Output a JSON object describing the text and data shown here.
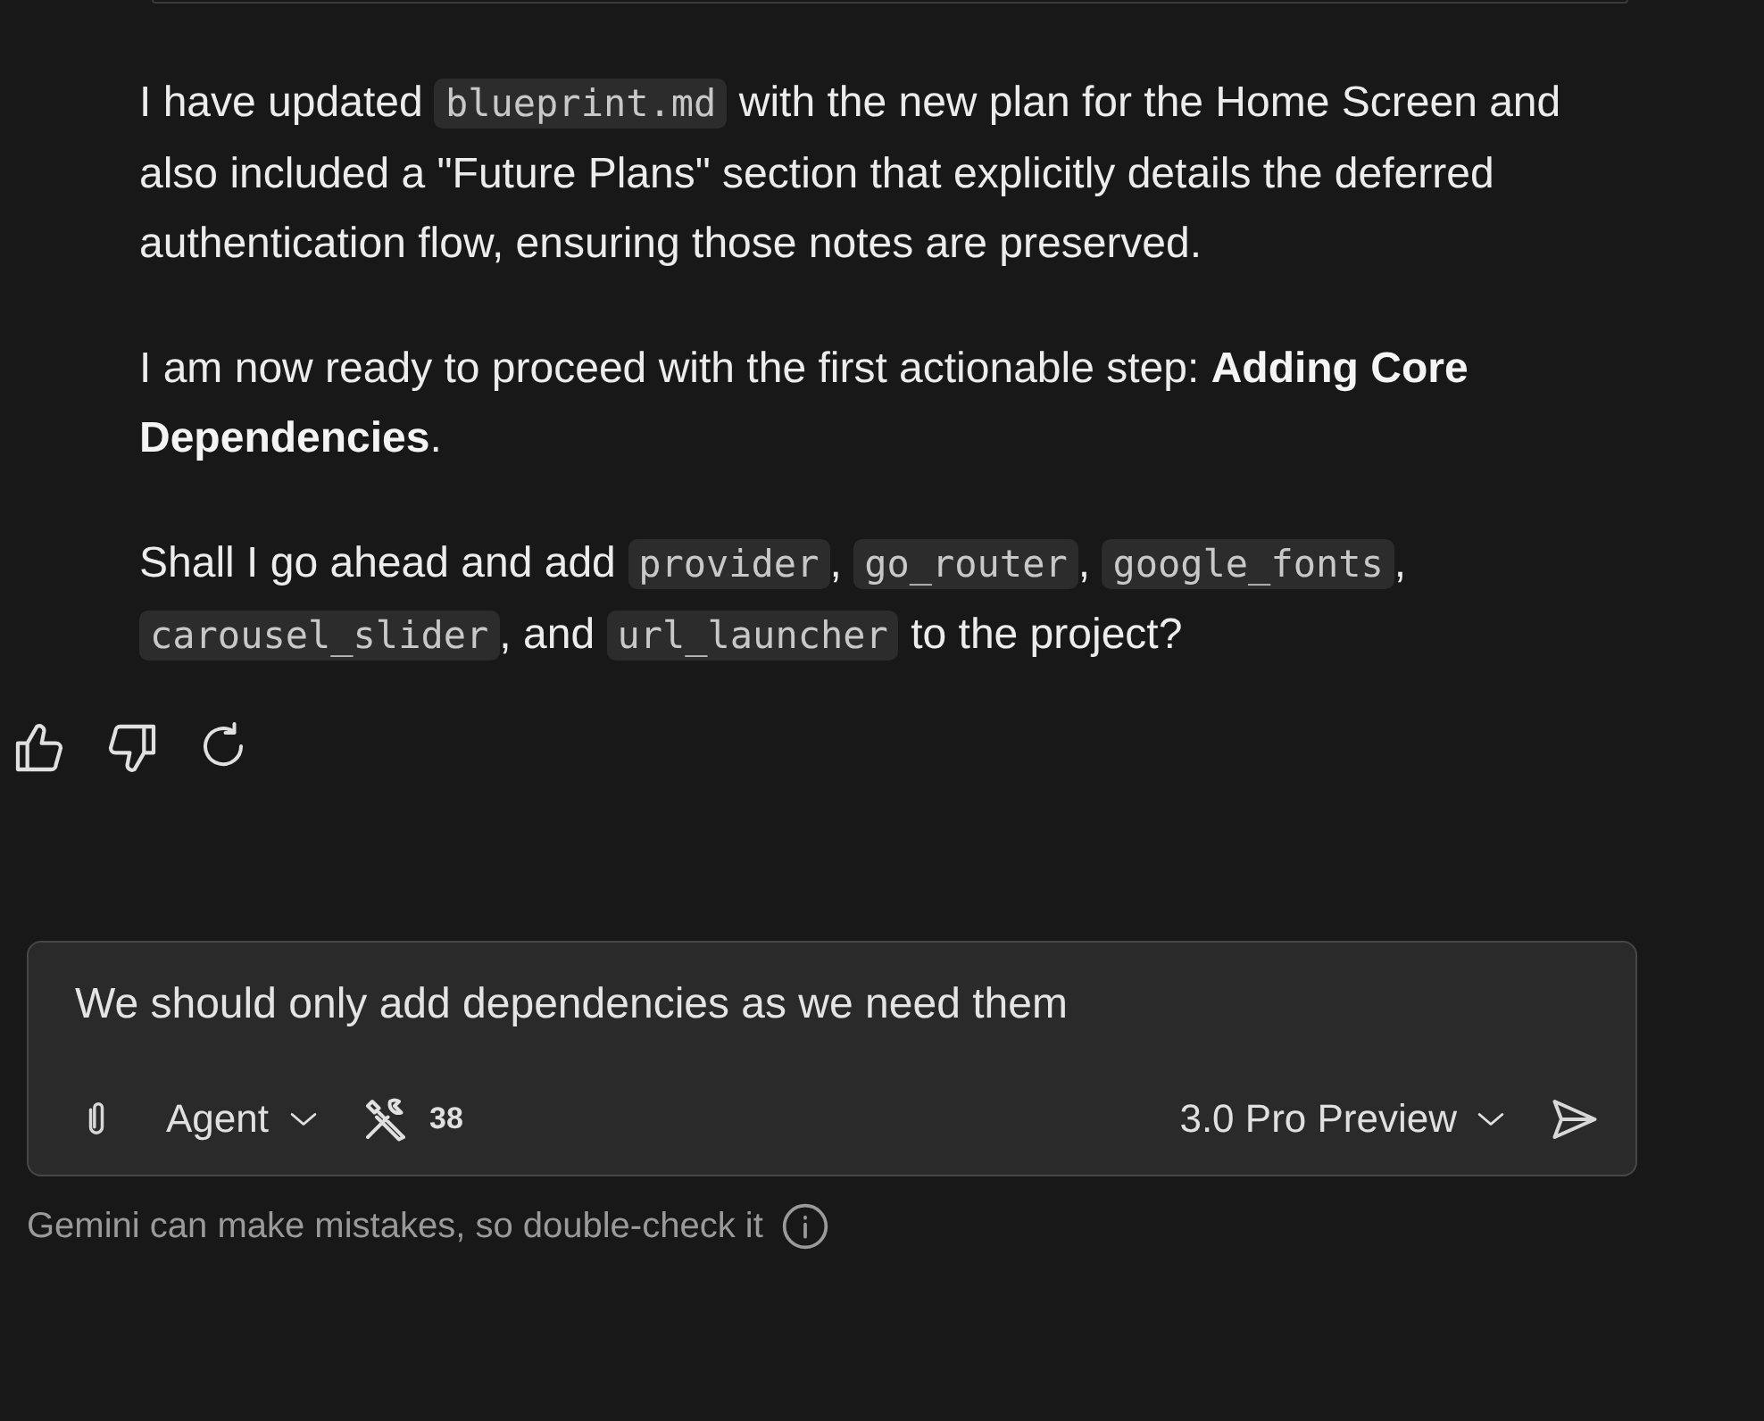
{
  "messages": [
    {
      "segments": [
        {
          "kind": "text",
          "text": "I have updated "
        },
        {
          "kind": "code",
          "text": "blueprint.md"
        },
        {
          "kind": "text",
          "text": " with the new plan for the Home Screen and also included a \"Future Plans\" section that explicitly details the deferred authentication flow, ensuring those notes are preserved."
        }
      ]
    },
    {
      "segments": [
        {
          "kind": "text",
          "text": "I am now ready to proceed with the first actionable step: "
        },
        {
          "kind": "bold",
          "text": "Adding Core Dependencies"
        },
        {
          "kind": "text",
          "text": "."
        }
      ]
    },
    {
      "segments": [
        {
          "kind": "text",
          "text": "Shall I go ahead and add "
        },
        {
          "kind": "code",
          "text": "provider"
        },
        {
          "kind": "text",
          "text": ", "
        },
        {
          "kind": "code",
          "text": "go_router"
        },
        {
          "kind": "text",
          "text": ", "
        },
        {
          "kind": "code",
          "text": "google_fonts"
        },
        {
          "kind": "text",
          "text": ", "
        },
        {
          "kind": "code",
          "text": "carousel_slider"
        },
        {
          "kind": "text",
          "text": ", and "
        },
        {
          "kind": "code",
          "text": "url_launcher"
        },
        {
          "kind": "text",
          "text": " to the project?"
        }
      ]
    }
  ],
  "composer": {
    "value": "We should only add dependencies as we need them",
    "mode": "Agent",
    "tools_count": "38",
    "model": "3.0 Pro Preview"
  },
  "disclaimer": "Gemini can make mistakes, so double-check it"
}
